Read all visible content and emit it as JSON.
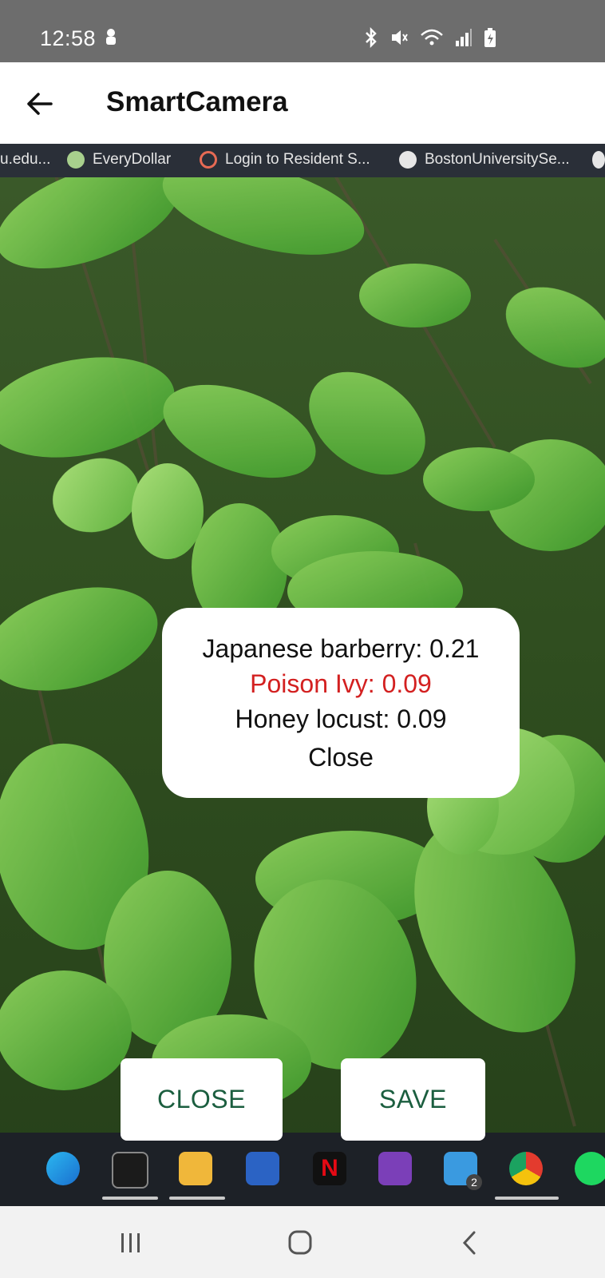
{
  "status": {
    "time": "12:58",
    "left_icon": "android-notification-icon",
    "right_icons": [
      "bluetooth-icon",
      "mute-icon",
      "wifi-icon",
      "signal-icon",
      "battery-charging-icon"
    ]
  },
  "app_bar": {
    "title": "SmartCamera",
    "back_icon": "arrow-left-icon"
  },
  "camera": {
    "bookmarks": [
      "u.edu...",
      "EveryDollar",
      "Login to Resident S...",
      "BostonUniversitySe..."
    ]
  },
  "results": {
    "lines": [
      {
        "text": "Japanese barberry: 0.21",
        "color": "#111111"
      },
      {
        "text": "Poison Ivy: 0.09",
        "color": "#d32020"
      },
      {
        "text": "Honey locust: 0.09",
        "color": "#111111"
      }
    ],
    "close_label": "Close"
  },
  "buttons": {
    "close_label": "CLOSE",
    "save_label": "SAVE"
  },
  "taskbar": {
    "badge": "2"
  },
  "colors": {
    "accent_text": "#1b5e3f",
    "highlight": "#d32020",
    "status_bar": "#6d6d6d"
  }
}
